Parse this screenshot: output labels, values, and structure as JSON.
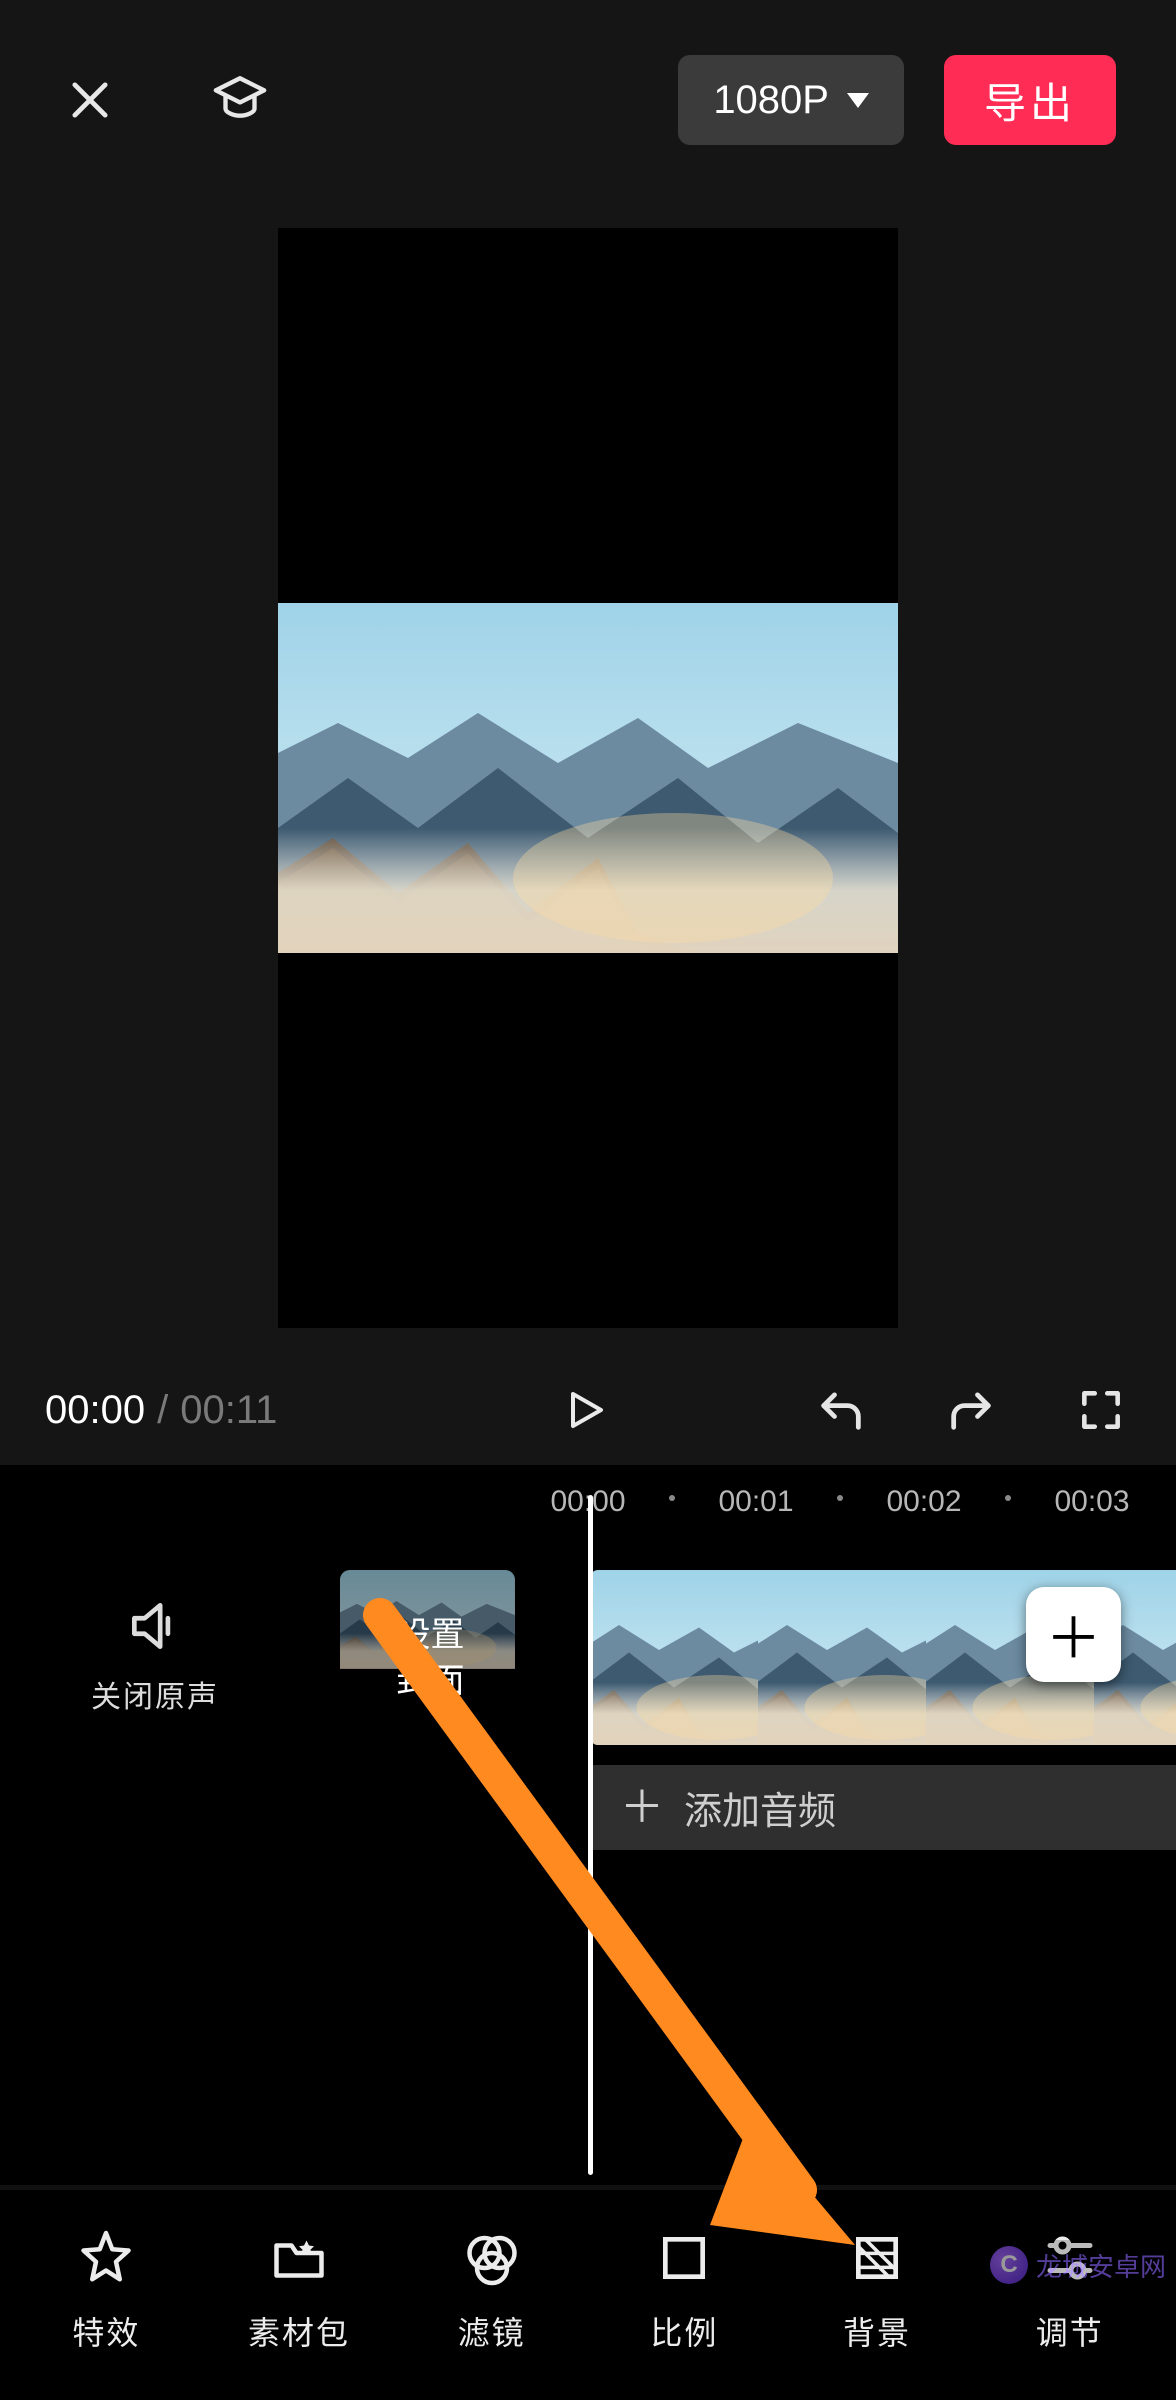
{
  "header": {
    "resolution_label": "1080P",
    "export_label": "导出"
  },
  "playback": {
    "current_time": "00:00",
    "separator": "/",
    "total_time": "00:11"
  },
  "timeline": {
    "ruler": [
      "00:00",
      "00:01",
      "00:02",
      "00:03"
    ],
    "mute_label": "关闭原声",
    "cover_label": "设置\n封面",
    "add_audio_label": "添加音频"
  },
  "bottom_tools": [
    {
      "id": "effects",
      "label": "特效"
    },
    {
      "id": "packs",
      "label": "素材包"
    },
    {
      "id": "filter",
      "label": "滤镜"
    },
    {
      "id": "ratio",
      "label": "比例"
    },
    {
      "id": "bg",
      "label": "背景"
    },
    {
      "id": "adjust",
      "label": "调节"
    }
  ],
  "watermark": {
    "text": "龙城安卓网"
  },
  "colors": {
    "accent": "#ff2d55",
    "arrow": "#ff8a1f"
  }
}
